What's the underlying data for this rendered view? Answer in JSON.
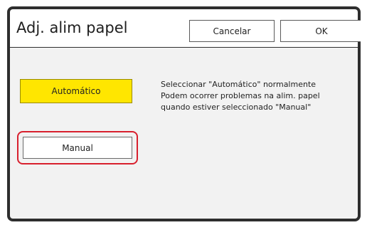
{
  "dialog": {
    "title": "Adj. alim papel",
    "cancel_label": "Cancelar",
    "ok_label": "OK"
  },
  "options": {
    "automatic_label": "Automático",
    "manual_label": "Manual",
    "selected": "Automático"
  },
  "info": {
    "line1": "Seleccionar \"Automático\" normalmente",
    "line2": "Podem ocorrer problemas na alim. papel",
    "line3": "quando estiver seleccionado \"Manual\""
  },
  "colors": {
    "selected_button": "#ffe600",
    "highlight_ring": "#d8202e",
    "frame": "#2e2e2e"
  }
}
